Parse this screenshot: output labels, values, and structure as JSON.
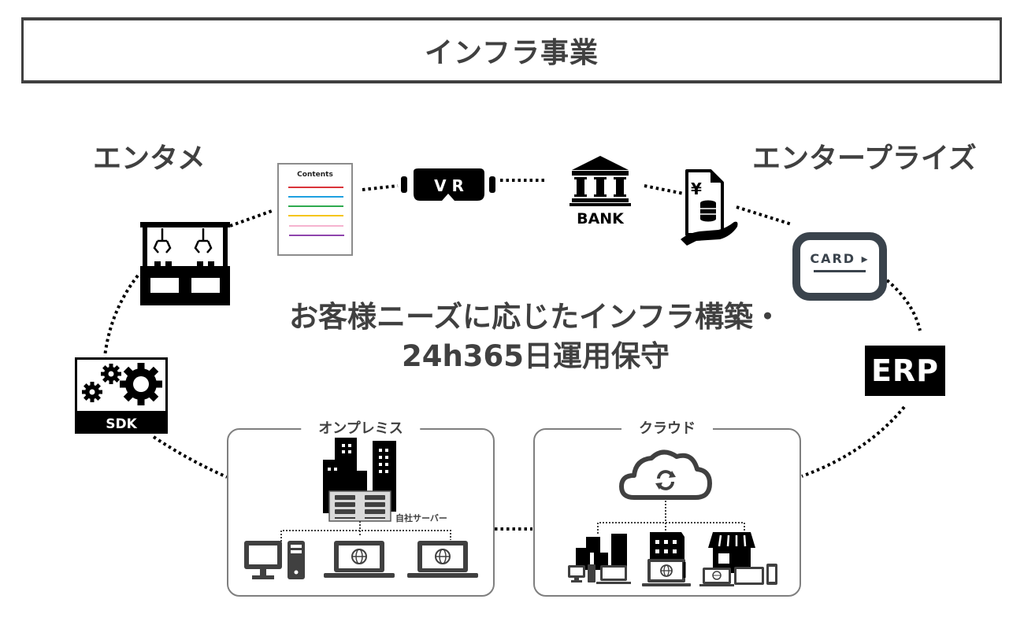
{
  "header": {
    "title": "インフラ事業"
  },
  "sections": {
    "left_label": "エンタメ",
    "right_label": "エンタープライズ"
  },
  "center": {
    "line1": "お客様ニーズに応じたインフラ構築・",
    "line2": "24h365日運用保守"
  },
  "icons": {
    "contents_doc": {
      "label": "Contents",
      "line_colors": [
        "#d9343a",
        "#1ea0e0",
        "#2eaa4f",
        "#f5c518",
        "#f5b3cf",
        "#8e44ad"
      ]
    },
    "vr": {
      "label": "V R"
    },
    "bank": {
      "label": "BANK"
    },
    "yen_doc": {
      "label": "¥"
    },
    "card": {
      "label": "CARD ▸"
    },
    "erp": {
      "label": "ERP"
    },
    "sdk": {
      "label": "SDK"
    }
  },
  "groups": {
    "onpremise": {
      "label": "オンプレミス",
      "server_label": "自社サーバー"
    },
    "cloud": {
      "label": "クラウド"
    }
  },
  "colors": {
    "text": "#404040",
    "icon": "#000000",
    "box_border": "#7f7f7f",
    "card_border": "#3a434c"
  }
}
